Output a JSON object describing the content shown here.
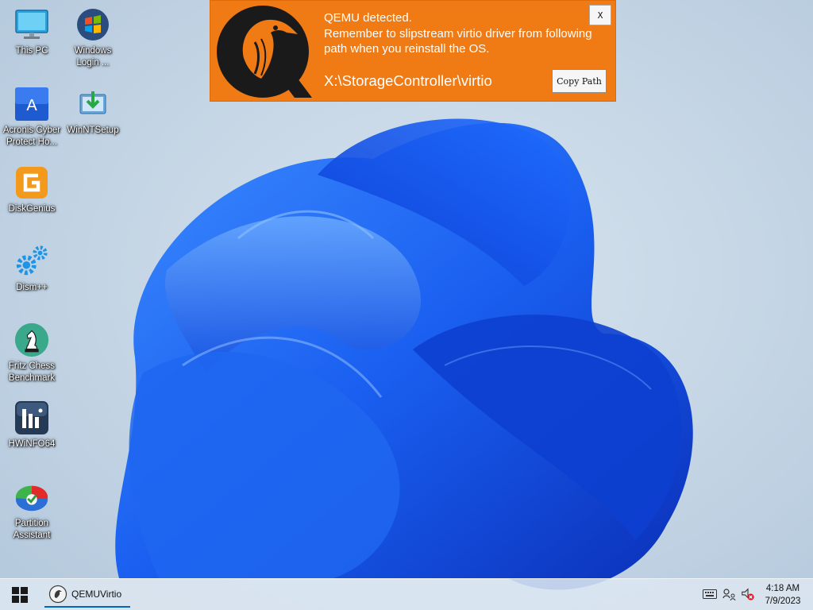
{
  "desktop": {
    "icons": [
      {
        "label": "This PC",
        "icon": "monitor-icon"
      },
      {
        "label": "Windows\nLogin ...",
        "icon": "windows-orb-icon"
      },
      {
        "label": "Acronis Cyber\nProtect Ho...",
        "icon": "acronis-icon"
      },
      {
        "label": "WinNTSetup",
        "icon": "winntsetup-icon"
      },
      {
        "label": "DiskGenius",
        "icon": "diskgenius-icon"
      },
      {
        "label": "Dism++",
        "icon": "gears-icon"
      },
      {
        "label": "Fritz Chess\nBenchmark",
        "icon": "chess-knight-icon"
      },
      {
        "label": "HWiNFO64",
        "icon": "hwinfo-icon"
      },
      {
        "label": "Partition\nAssistant",
        "icon": "partition-assistant-icon"
      }
    ]
  },
  "banner": {
    "background": "#f07a14",
    "logo_letter": "Q",
    "message": "QEMU detected.\nRemember to slipstream virtio driver from following path when you reinstall the OS.",
    "path": "X:\\StorageController\\virtio",
    "copy_label": "Copy Path",
    "close_label": "X"
  },
  "taskbar": {
    "task_label": "QEMUVirtio",
    "time": "4:18 AM",
    "date": "7/9/2023",
    "tray_icons": [
      "keyboard-icon",
      "network-icon",
      "volume-muted-icon"
    ]
  }
}
